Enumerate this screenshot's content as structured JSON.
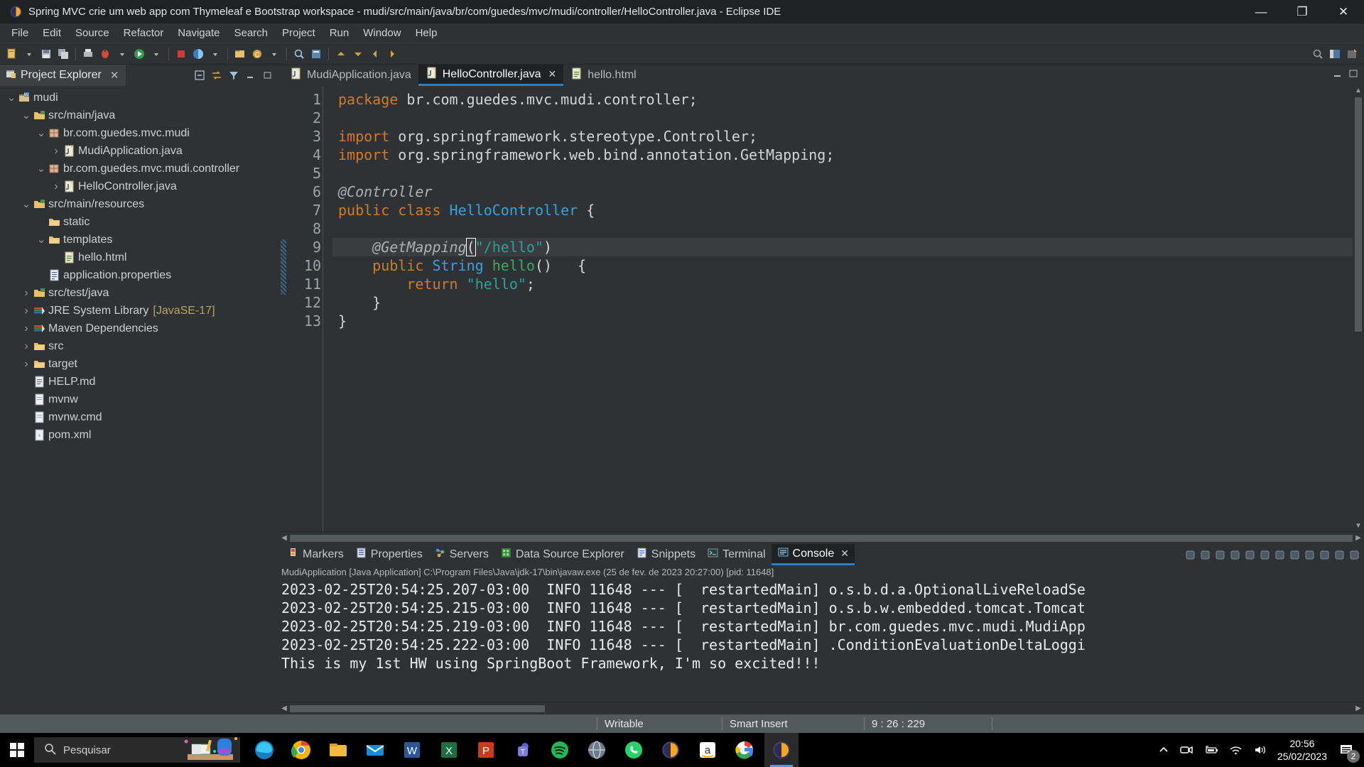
{
  "window": {
    "title": "Spring MVC crie um web app com Thymeleaf e Bootstrap workspace - mudi/src/main/java/br/com/guedes/mvc/mudi/controller/HelloController.java - Eclipse IDE",
    "minimize": "—",
    "maximize": "❐",
    "close": "✕"
  },
  "menu": {
    "items": [
      {
        "label": "File"
      },
      {
        "label": "Edit"
      },
      {
        "label": "Source"
      },
      {
        "label": "Refactor"
      },
      {
        "label": "Navigate"
      },
      {
        "label": "Search"
      },
      {
        "label": "Project"
      },
      {
        "label": "Run"
      },
      {
        "label": "Window"
      },
      {
        "label": "Help"
      }
    ]
  },
  "explorer": {
    "tab_label": "Project Explorer",
    "close_label": "✕",
    "tree": [
      {
        "indent": 0,
        "twisty": "v",
        "icon": "project-icon",
        "label": "mudi",
        "suffix": ""
      },
      {
        "indent": 1,
        "twisty": "v",
        "icon": "source-folder-icon",
        "label": "src/main/java",
        "suffix": ""
      },
      {
        "indent": 2,
        "twisty": "v",
        "icon": "package-icon",
        "label": "br.com.guedes.mvc.mudi",
        "suffix": ""
      },
      {
        "indent": 3,
        "twisty": ">",
        "icon": "java-file-icon",
        "label": "MudiApplication.java",
        "suffix": ""
      },
      {
        "indent": 2,
        "twisty": "v",
        "icon": "package-icon",
        "label": "br.com.guedes.mvc.mudi.controller",
        "suffix": ""
      },
      {
        "indent": 3,
        "twisty": ">",
        "icon": "java-file-icon",
        "label": "HelloController.java",
        "suffix": ""
      },
      {
        "indent": 1,
        "twisty": "v",
        "icon": "source-folder-icon",
        "label": "src/main/resources",
        "suffix": ""
      },
      {
        "indent": 2,
        "twisty": "",
        "icon": "folder-icon",
        "label": "static",
        "suffix": ""
      },
      {
        "indent": 2,
        "twisty": "v",
        "icon": "folder-icon",
        "label": "templates",
        "suffix": ""
      },
      {
        "indent": 3,
        "twisty": "",
        "icon": "html-file-icon",
        "label": "hello.html",
        "suffix": ""
      },
      {
        "indent": 2,
        "twisty": "",
        "icon": "properties-file-icon",
        "label": "application.properties",
        "suffix": ""
      },
      {
        "indent": 1,
        "twisty": ">",
        "icon": "source-folder-icon",
        "label": "src/test/java",
        "suffix": ""
      },
      {
        "indent": 1,
        "twisty": ">",
        "icon": "library-icon",
        "label": "JRE System Library",
        "suffix": "[JavaSE-17]"
      },
      {
        "indent": 1,
        "twisty": ">",
        "icon": "library-icon",
        "label": "Maven Dependencies",
        "suffix": ""
      },
      {
        "indent": 1,
        "twisty": ">",
        "icon": "folder-icon",
        "label": "src",
        "suffix": ""
      },
      {
        "indent": 1,
        "twisty": ">",
        "icon": "folder-icon",
        "label": "target",
        "suffix": ""
      },
      {
        "indent": 1,
        "twisty": "",
        "icon": "md-file-icon",
        "label": "HELP.md",
        "suffix": ""
      },
      {
        "indent": 1,
        "twisty": "",
        "icon": "file-icon",
        "label": "mvnw",
        "suffix": ""
      },
      {
        "indent": 1,
        "twisty": "",
        "icon": "file-icon",
        "label": "mvnw.cmd",
        "suffix": ""
      },
      {
        "indent": 1,
        "twisty": "",
        "icon": "xml-file-icon",
        "label": "pom.xml",
        "suffix": ""
      }
    ]
  },
  "editor": {
    "tabs": [
      {
        "label": "MudiApplication.java",
        "icon": "java-file-icon",
        "active": false,
        "closable": false
      },
      {
        "label": "HelloController.java",
        "icon": "java-file-icon",
        "active": true,
        "closable": true
      },
      {
        "label": "hello.html",
        "icon": "html-file-icon",
        "active": false,
        "closable": false
      }
    ],
    "close_label": "✕",
    "lines": [
      {
        "num": "1",
        "marker": false,
        "highlight": false,
        "tokens": [
          {
            "t": "package ",
            "c": "k"
          },
          {
            "t": "br.com.guedes.mvc.mudi.controller;",
            "c": "pl"
          }
        ]
      },
      {
        "num": "2",
        "marker": false,
        "highlight": false,
        "tokens": []
      },
      {
        "num": "3",
        "marker": true,
        "highlight": false,
        "tokens": [
          {
            "t": "import ",
            "c": "k"
          },
          {
            "t": "org.springframework.stereotype.Controller;",
            "c": "pl"
          }
        ]
      },
      {
        "num": "4",
        "marker": false,
        "highlight": false,
        "tokens": [
          {
            "t": "import ",
            "c": "k"
          },
          {
            "t": "org.springframework.web.bind.annotation.GetMapping;",
            "c": "pl"
          }
        ]
      },
      {
        "num": "5",
        "marker": false,
        "highlight": false,
        "tokens": []
      },
      {
        "num": "6",
        "marker": false,
        "highlight": false,
        "tokens": [
          {
            "t": "@Controller",
            "c": "ann"
          }
        ]
      },
      {
        "num": "7",
        "marker": false,
        "highlight": false,
        "tokens": [
          {
            "t": "public class ",
            "c": "k"
          },
          {
            "t": "HelloController",
            "c": "ty"
          },
          {
            "t": " {",
            "c": "pl"
          }
        ]
      },
      {
        "num": "8",
        "marker": false,
        "highlight": false,
        "tokens": []
      },
      {
        "num": "9",
        "marker": true,
        "highlight": true,
        "tokens": [
          {
            "t": "    @GetMapping",
            "c": "ann"
          },
          {
            "t": "(",
            "c": "brk"
          },
          {
            "t": "\"/hello\"",
            "c": "str"
          },
          {
            "t": ")",
            "c": "pl"
          }
        ]
      },
      {
        "num": "10",
        "marker": false,
        "highlight": false,
        "tokens": [
          {
            "t": "    public ",
            "c": "k"
          },
          {
            "t": "String ",
            "c": "ty"
          },
          {
            "t": "hello",
            "c": "mth"
          },
          {
            "t": "()   {",
            "c": "pl"
          }
        ]
      },
      {
        "num": "11",
        "marker": false,
        "highlight": false,
        "tokens": [
          {
            "t": "        return ",
            "c": "k"
          },
          {
            "t": "\"hello\"",
            "c": "str"
          },
          {
            "t": ";",
            "c": "pl"
          }
        ]
      },
      {
        "num": "12",
        "marker": false,
        "highlight": false,
        "tokens": [
          {
            "t": "    }",
            "c": "pl"
          }
        ]
      },
      {
        "num": "13",
        "marker": false,
        "highlight": false,
        "tokens": [
          {
            "t": "}",
            "c": "pl"
          }
        ]
      }
    ]
  },
  "bottom_panel": {
    "tabs": [
      {
        "label": "Markers",
        "icon": "markers-icon",
        "active": false,
        "closable": false
      },
      {
        "label": "Properties",
        "icon": "properties-icon",
        "active": false,
        "closable": false
      },
      {
        "label": "Servers",
        "icon": "servers-icon",
        "active": false,
        "closable": false
      },
      {
        "label": "Data Source Explorer",
        "icon": "datasource-icon",
        "active": false,
        "closable": false
      },
      {
        "label": "Snippets",
        "icon": "snippets-icon",
        "active": false,
        "closable": false
      },
      {
        "label": "Terminal",
        "icon": "terminal-icon",
        "active": false,
        "closable": false
      },
      {
        "label": "Console",
        "icon": "console-icon",
        "active": true,
        "closable": true
      }
    ],
    "close_label": "✕",
    "process_line": "MudiApplication [Java Application] C:\\Program Files\\Java\\jdk-17\\bin\\javaw.exe  (25 de fev. de 2023 20:27:00) [pid: 11648]",
    "console_lines": [
      "2023-02-25T20:54:25.207-03:00  INFO 11648 --- [  restartedMain] o.s.b.d.a.OptionalLiveReloadSe",
      "2023-02-25T20:54:25.215-03:00  INFO 11648 --- [  restartedMain] o.s.b.w.embedded.tomcat.Tomcat",
      "2023-02-25T20:54:25.219-03:00  INFO 11648 --- [  restartedMain] br.com.guedes.mvc.mudi.MudiApp",
      "2023-02-25T20:54:25.222-03:00  INFO 11648 --- [  restartedMain] .ConditionEvaluationDeltaLoggi",
      "This is my 1st HW using SpringBoot Framework, I'm so excited!!!"
    ]
  },
  "statusbar": {
    "writable": "Writable",
    "insert_mode": "Smart Insert",
    "position": "9 : 26 : 229"
  },
  "taskbar": {
    "search_placeholder": "Pesquisar",
    "time": "20:56",
    "date": "25/02/2023",
    "notification_count": "2",
    "apps": [
      {
        "name": "edge-icon"
      },
      {
        "name": "chrome-icon"
      },
      {
        "name": "file-explorer-icon"
      },
      {
        "name": "mail-icon"
      },
      {
        "name": "word-icon"
      },
      {
        "name": "excel-icon"
      },
      {
        "name": "powerpoint-icon"
      },
      {
        "name": "teams-icon"
      },
      {
        "name": "spotify-icon"
      },
      {
        "name": "browser-icon"
      },
      {
        "name": "whatsapp-icon"
      },
      {
        "name": "eclipse-icon"
      },
      {
        "name": "amazon-icon"
      },
      {
        "name": "google-icon"
      },
      {
        "name": "eclipse-ide-icon"
      }
    ]
  }
}
